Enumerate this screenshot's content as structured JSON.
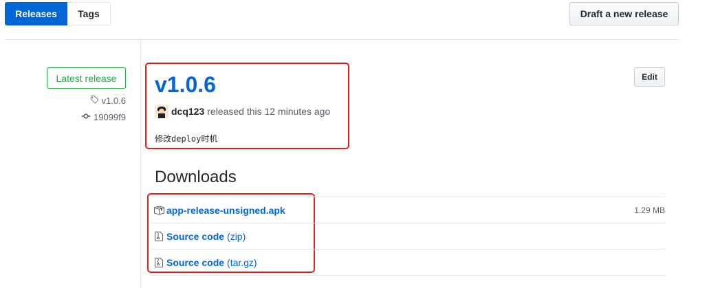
{
  "tabs": [
    {
      "label": "Releases",
      "active": true
    },
    {
      "label": "Tags",
      "active": false
    }
  ],
  "draft_button": "Draft a new release",
  "sidebar": {
    "badge": "Latest release",
    "tag": "v1.0.6",
    "commit": "19099f9"
  },
  "release": {
    "title": "v1.0.6",
    "author": "dcq123",
    "byline": "released this 12 minutes ago",
    "notes": "修改deploy时机",
    "edit_label": "Edit"
  },
  "downloads": {
    "heading": "Downloads",
    "items": [
      {
        "name": "app-release-unsigned.apk",
        "ext": "",
        "size": "1.29 MB",
        "icon": "package-icon"
      },
      {
        "name": "Source code",
        "ext": "(zip)",
        "size": "",
        "icon": "file-zip-icon"
      },
      {
        "name": "Source code",
        "ext": "(tar.gz)",
        "size": "",
        "icon": "file-zip-icon"
      }
    ]
  },
  "colors": {
    "accent": "#0366d6",
    "latest": "#28a745",
    "highlight": "#e02020"
  }
}
